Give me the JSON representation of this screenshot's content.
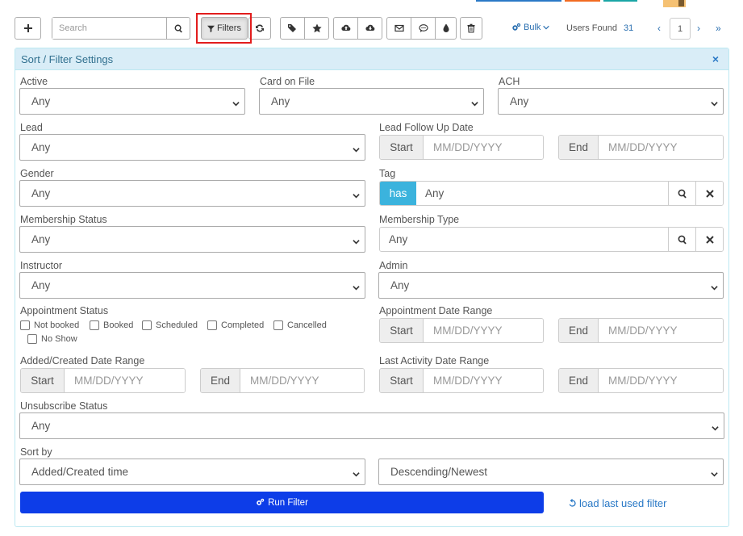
{
  "toolbar": {
    "search_placeholder": "Search",
    "filters_label": "Filters",
    "bulk_label": "Bulk",
    "users_found_label": "Users Found",
    "users_found_count": "31",
    "page_number": "1",
    "prev_glyph": "‹",
    "next_glyph": "›",
    "last_glyph": "»"
  },
  "panel": {
    "title": "Sort / Filter Settings",
    "close_glyph": "×"
  },
  "fields": {
    "active": {
      "label": "Active",
      "value": "Any"
    },
    "card_on_file": {
      "label": "Card on File",
      "value": "Any"
    },
    "ach": {
      "label": "ACH",
      "value": "Any"
    },
    "lead": {
      "label": "Lead",
      "value": "Any"
    },
    "lead_follow_up": {
      "label": "Lead Follow Up Date",
      "start_label": "Start",
      "end_label": "End",
      "placeholder": "MM/DD/YYYY"
    },
    "gender": {
      "label": "Gender",
      "value": "Any"
    },
    "tag": {
      "label": "Tag",
      "has_label": "has",
      "value": "Any"
    },
    "membership_status": {
      "label": "Membership Status",
      "value": "Any"
    },
    "membership_type": {
      "label": "Membership Type",
      "value": "Any"
    },
    "instructor": {
      "label": "Instructor",
      "value": "Any"
    },
    "admin": {
      "label": "Admin",
      "value": "Any"
    },
    "appointment_status": {
      "label": "Appointment Status",
      "options": [
        "Not booked",
        "Booked",
        "Scheduled",
        "Completed",
        "Cancelled",
        "No Show"
      ]
    },
    "appointment_date_range": {
      "label": "Appointment Date Range",
      "start_label": "Start",
      "end_label": "End",
      "placeholder": "MM/DD/YYYY"
    },
    "added_created_range": {
      "label": "Added/Created Date Range",
      "start_label": "Start",
      "end_label": "End",
      "placeholder": "MM/DD/YYYY"
    },
    "last_activity_range": {
      "label": "Last Activity Date Range",
      "start_label": "Start",
      "end_label": "End",
      "placeholder": "MM/DD/YYYY"
    },
    "unsubscribe_status": {
      "label": "Unsubscribe Status",
      "value": "Any"
    },
    "sort_by": {
      "label": "Sort by",
      "field_value": "Added/Created time",
      "order_value": "Descending/Newest"
    }
  },
  "actions": {
    "run_filter_label": "Run Filter",
    "load_last_label": "load last used filter"
  },
  "colors": {
    "panel_header_bg": "#d9edf7",
    "run_button_bg": "#0d3de8",
    "tag_has_bg": "#3bb3dd",
    "highlight_border": "#e21d1d",
    "link": "#2a79c6"
  }
}
